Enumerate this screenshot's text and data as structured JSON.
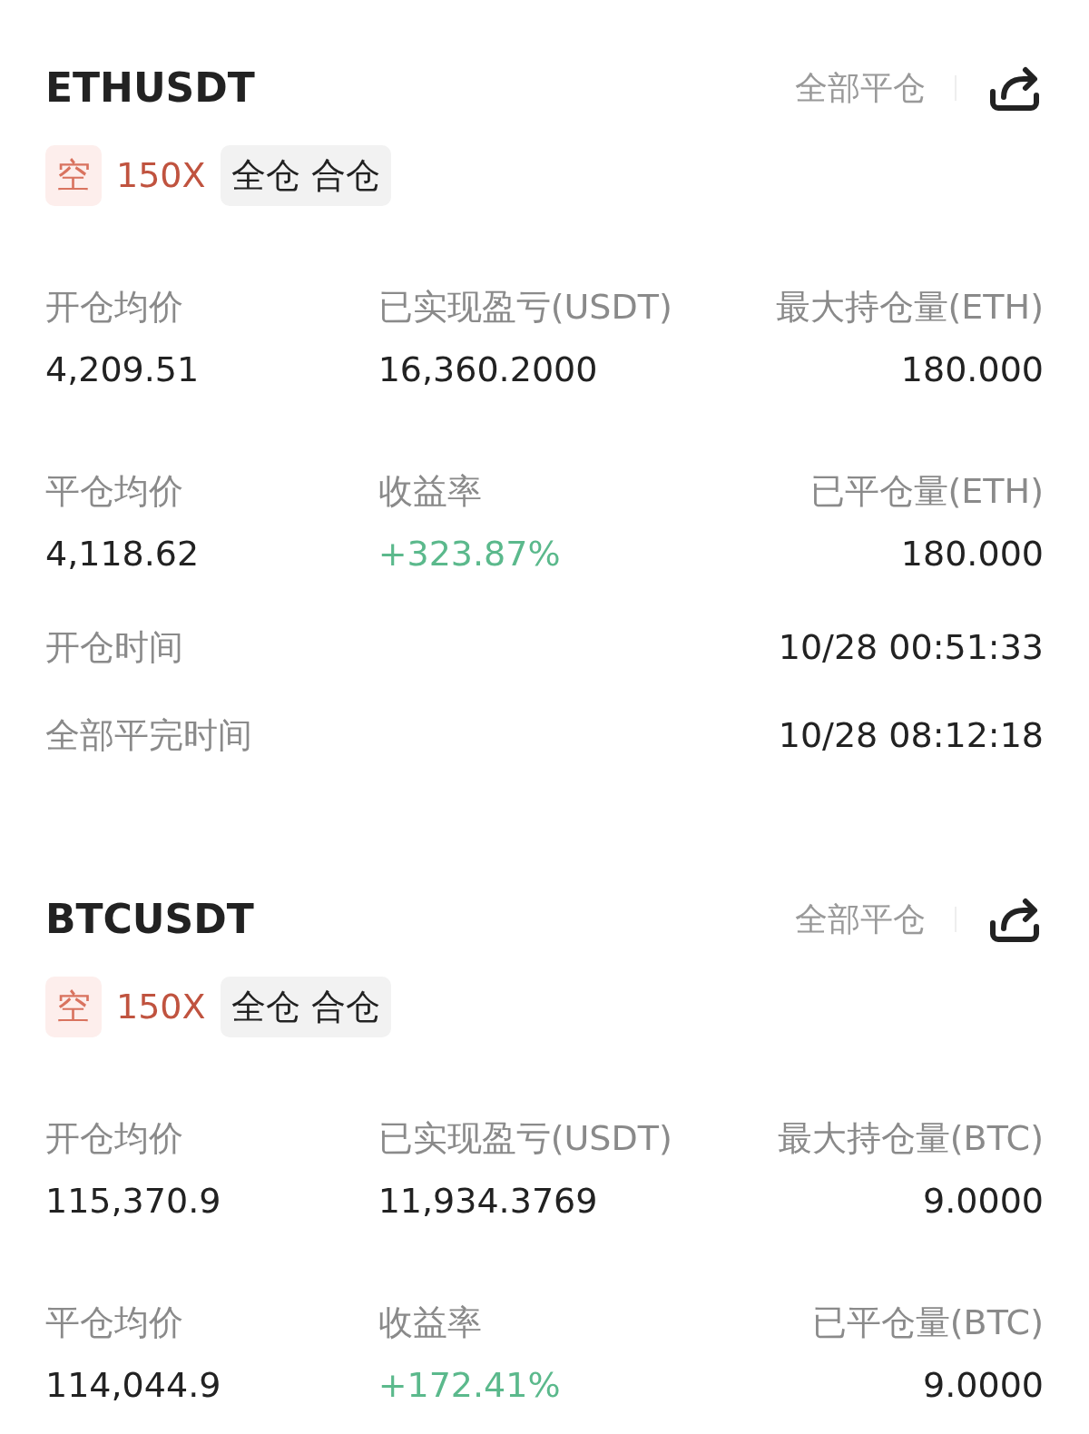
{
  "positions": [
    {
      "symbol": "ETHUSDT",
      "close_all": "全部平仓",
      "side": "空",
      "leverage": "150X",
      "margin_mode": "全仓 合仓",
      "stats": [
        {
          "label": "开仓均价",
          "value": "4,209.51",
          "kind": "plain"
        },
        {
          "label": "已实现盈亏(USDT)",
          "value": "16,360.2000",
          "kind": "plain"
        },
        {
          "label": "最大持仓量(ETH)",
          "value": "180.000",
          "kind": "plain"
        },
        {
          "label": "平仓均价",
          "value": "4,118.62",
          "kind": "plain"
        },
        {
          "label": "收益率",
          "value": "+323.87%",
          "kind": "gain"
        },
        {
          "label": "已平仓量(ETH)",
          "value": "180.000",
          "kind": "plain"
        }
      ],
      "times": [
        {
          "label": "开仓时间",
          "value": "10/28 00:51:33"
        },
        {
          "label": "全部平完时间",
          "value": "10/28 08:12:18"
        }
      ]
    },
    {
      "symbol": "BTCUSDT",
      "close_all": "全部平仓",
      "side": "空",
      "leverage": "150X",
      "margin_mode": "全仓 合仓",
      "stats": [
        {
          "label": "开仓均价",
          "value": "115,370.9",
          "kind": "plain"
        },
        {
          "label": "已实现盈亏(USDT)",
          "value": "11,934.3769",
          "kind": "plain"
        },
        {
          "label": "最大持仓量(BTC)",
          "value": "9.0000",
          "kind": "plain"
        },
        {
          "label": "平仓均价",
          "value": "114,044.9",
          "kind": "plain"
        },
        {
          "label": "收益率",
          "value": "+172.41%",
          "kind": "gain"
        },
        {
          "label": "已平仓量(BTC)",
          "value": "9.0000",
          "kind": "plain"
        }
      ]
    }
  ]
}
